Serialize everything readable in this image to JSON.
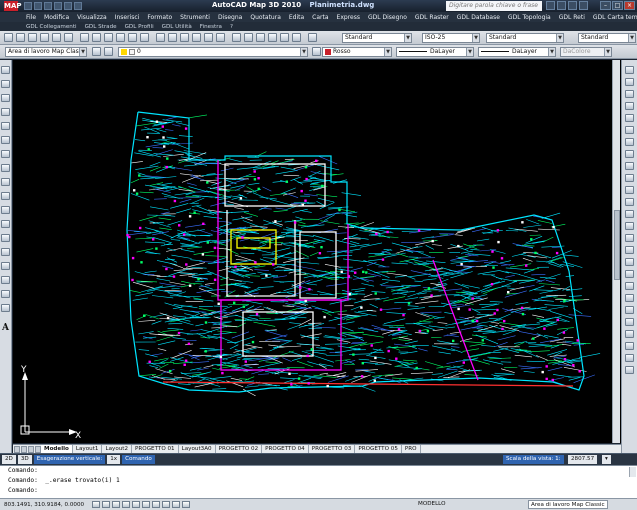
{
  "window": {
    "app_title": "AutoCAD Map 3D 2010",
    "document_title": "Planimetria.dwg",
    "search_placeholder": "Digitare parola chiave o frase",
    "app_icon": "MAP"
  },
  "menu": [
    "File",
    "Modifica",
    "Visualizza",
    "Inserisci",
    "Formato",
    "Strumenti",
    "Disegna",
    "Quotatura",
    "Edita",
    "Carta",
    "Express",
    "GDL Disegno",
    "GDL Raster",
    "GDL Database",
    "GDL Topologia",
    "GDL Reti",
    "GDL Carta tematica"
  ],
  "menu2": [
    "GDL Collegamenti",
    "GDL Strade",
    "GDL Profili",
    "GDL Utilità",
    "Finestra",
    "?"
  ],
  "toolbar1": {
    "text_style": "Standard",
    "dim_style": "ISO-25",
    "table_style": "Standard",
    "multileader_style": "Standard"
  },
  "toolbar2": {
    "workspace": "Area di lavoro Map Classic",
    "layer": "0",
    "color_label": "Rosso",
    "color_hex": "#c8202a",
    "linetype": "DaLayer",
    "lineweight": "DaLayer",
    "plotstyle": "DaColore"
  },
  "ucs": {
    "x_label": "X",
    "y_label": "Y"
  },
  "layout_tabs": [
    "Modello",
    "Layout1",
    "Layout2",
    "PROGETTO 01",
    "Layout3A0",
    "PROGETTO 02",
    "PROGETTO 04",
    "PROGETTO 03",
    "PROGETTO 05",
    "PRO"
  ],
  "active_tab": "Modello",
  "viewbar": {
    "btn_2d": "2D",
    "btn_3d": "3D",
    "exaggeration_label": "Esagerazione verticale:",
    "exaggeration_value": "1x",
    "command_btn": "Comando",
    "scale_label": "Scala della vista: 1:",
    "scale_value": "2807.57"
  },
  "command_history": [
    "Comando:",
    "Comando:  _.erase trovato(i) 1"
  ],
  "command_prompt": "Comando:",
  "status": {
    "coordinates": "803.1491, 310.9184, 0.0000",
    "model_label": "MODELLO",
    "workspace_label": "Area di lavoro Map Classic"
  },
  "colors": {
    "canvas": "#000000",
    "cyan": "#00e5ff",
    "magenta": "#ff00ff",
    "yellow": "#ffff00",
    "white": "#ffffff",
    "green": "#00ff66",
    "blue": "#3a6fff",
    "red": "#ff3030"
  }
}
